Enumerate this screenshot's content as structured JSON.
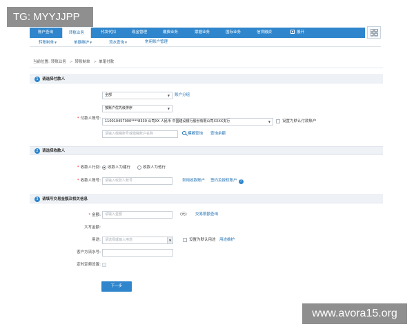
{
  "overlay": {
    "tag": "TG: MYYJJPP",
    "watermark": "www.avora15.org"
  },
  "nav": {
    "items": [
      "账户查询",
      "转账业务",
      "代发代扣",
      "现金管理",
      "缴费业务",
      "票据业务",
      "国际业务",
      "信贷融资",
      "展开"
    ],
    "active_index": 1
  },
  "subnav": {
    "items": [
      "转账制单",
      "单据维护",
      "流水查询",
      "常用账户管理"
    ]
  },
  "breadcrumb": {
    "prefix": "当前位置:",
    "items": [
      "转账业务",
      "转账制单",
      "单笔付款"
    ]
  },
  "sections": {
    "payer": {
      "num": "1",
      "title": "请选择付款人"
    },
    "payee": {
      "num": "2",
      "title": "请选择收款人"
    },
    "amount": {
      "num": "3",
      "title": "请填写交易金额及相关信息"
    }
  },
  "payer": {
    "group_select": "全部",
    "group_link": "账户分组",
    "sort_select": "按账户优先级排序",
    "account_label": "付款人账号:",
    "account_value": "110010457000****8330 公司XX 人民币 中国建设银行股份有限公司XXXX支行",
    "default_checkbox_label": "设置为默认付款账户",
    "search_placeholder": "请输入模糊账号或模糊账户名称",
    "fuzzy_search_link": "模糊查询",
    "balance_link": "查询余额"
  },
  "payee": {
    "bank_label": "收款人行别:",
    "radio_same": "收款人为建行",
    "radio_other": "收款人为他行",
    "account_label": "收款人账号:",
    "account_placeholder": "请输入收款人账号",
    "common_link": "常用收款账户",
    "signed_link": "签约及授权账户"
  },
  "amount": {
    "amount_label": "金额:",
    "amount_placeholder": "请输入金额",
    "unit": "(元)",
    "limit_link": "交易限额查询",
    "uppercase_label": "大写金额:",
    "purpose_label": "用途:",
    "purpose_placeholder": "请选择或输入用途",
    "default_purpose_label": "设置为默认用途",
    "purpose_maint_link": "用途维护",
    "serial_label": "客户方流水号:",
    "schedule_label": "定时定频设置:"
  },
  "next_button": "下一步"
}
